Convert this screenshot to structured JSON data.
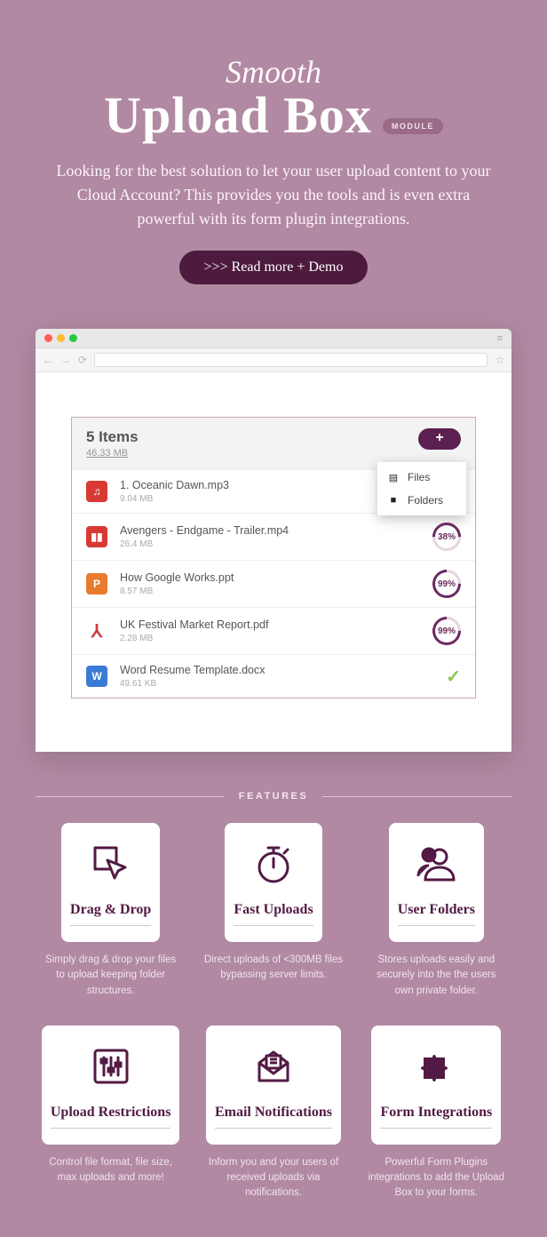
{
  "hero": {
    "script": "Smooth",
    "title": "Upload Box",
    "badge": "MODULE",
    "lede": "Looking for the best solution to let your user upload content to your Cloud Account? This provides you the tools and is even extra powerful with its form plugin integrations.",
    "cta": ">>> Read more + Demo"
  },
  "upload": {
    "count_label": "5 Items",
    "total_size": "46.33 MB",
    "popover": {
      "files": "Files",
      "folders": "Folders"
    },
    "rows": [
      {
        "name": "1. Oceanic Dawn.mp3",
        "size": "9.04 MB",
        "status": "none"
      },
      {
        "name": "Avengers - Endgame - Trailer.mp4",
        "size": "26.4 MB",
        "status": "38%"
      },
      {
        "name": "How Google Works.ppt",
        "size": "8.57 MB",
        "status": "99%"
      },
      {
        "name": "UK Festival Market Report.pdf",
        "size": "2.28 MB",
        "status": "99%"
      },
      {
        "name": "Word Resume Template.docx",
        "size": "49.61 KB",
        "status": "done"
      }
    ]
  },
  "features": {
    "heading": "FEATURES",
    "items": [
      {
        "title": "Drag & Drop",
        "desc": "Simply drag & drop your files to upload keeping folder structures."
      },
      {
        "title": "Fast Uploads",
        "desc": "Direct uploads of <300MB files bypassing server limits."
      },
      {
        "title": "User Folders",
        "desc": "Stores uploads easily and securely into the the users own private folder."
      },
      {
        "title": "Upload Restrictions",
        "desc": "Control file format, file size, max uploads and more!"
      },
      {
        "title": "Email Notifications",
        "desc": "Inform you and your users of received uploads via notifications."
      },
      {
        "title": "Form Integrations",
        "desc": "Powerful Form Plugins integrations to add the Upload Box to your forms."
      }
    ]
  }
}
